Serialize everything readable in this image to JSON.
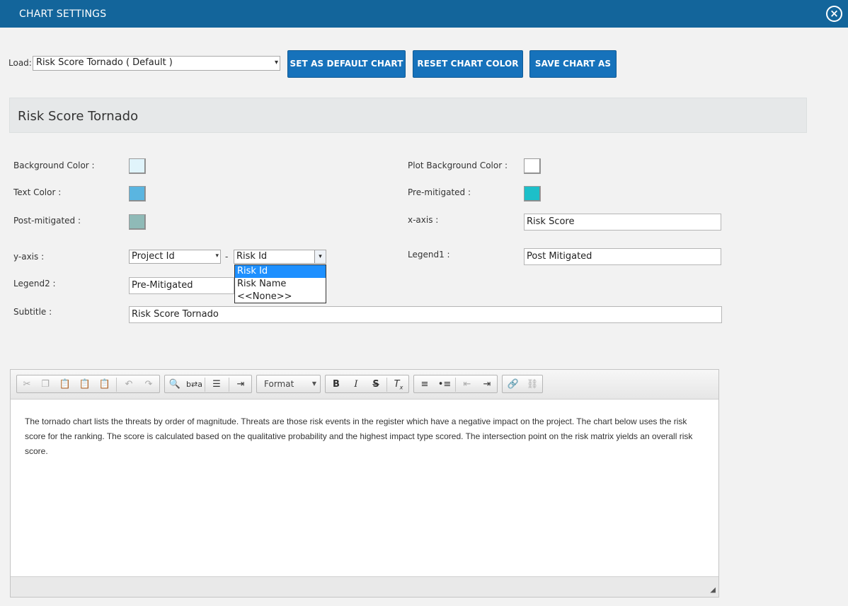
{
  "window": {
    "title": "CHART SETTINGS"
  },
  "load": {
    "label": "Load:",
    "selected": "Risk Score Tornado ( Default )"
  },
  "buttons": {
    "set_default": "SET AS DEFAULT CHART",
    "reset_color": "RESET CHART COLOR",
    "save_as": "SAVE CHART AS"
  },
  "panel": {
    "title": "Risk Score Tornado"
  },
  "fields": {
    "background_color": {
      "label": "Background Color :",
      "color": "#e0f4fb"
    },
    "plot_background_color": {
      "label": "Plot Background Color :",
      "color": "#ffffff"
    },
    "text_color": {
      "label": "Text Color :",
      "color": "#5ab5e0"
    },
    "pre_mitigated": {
      "label": "Pre-mitigated :",
      "color": "#1dbfc9"
    },
    "post_mitigated": {
      "label": "Post-mitigated :",
      "color": "#8fbab7"
    },
    "x_axis": {
      "label": "x-axis :",
      "value": "Risk Score"
    },
    "y_axis": {
      "label": "y-axis :",
      "primary": "Project Id",
      "separator": "-",
      "secondary": "Risk Id",
      "options": [
        "Risk Id",
        "Risk Name",
        "<<None>>"
      ]
    },
    "legend1": {
      "label": "Legend1 :",
      "value": "Post Mitigated"
    },
    "legend2": {
      "label": "Legend2 :",
      "value": "Pre-Mitigated"
    },
    "subtitle": {
      "label": "Subtitle :",
      "value": "Risk Score Tornado"
    }
  },
  "editor": {
    "format_label": "Format",
    "content": "The tornado chart lists the threats by order of magnitude. Threats are those risk events in the register which have a negative impact on the project. The chart below uses the risk score for the ranking. The score is calculated based on the qualitative probability and the highest impact type scored. The intersection point on the risk matrix yields an overall risk score."
  },
  "colors": {
    "titlebar": "#13659b",
    "button": "#1672bb",
    "selected_option": "#1e90ff"
  }
}
